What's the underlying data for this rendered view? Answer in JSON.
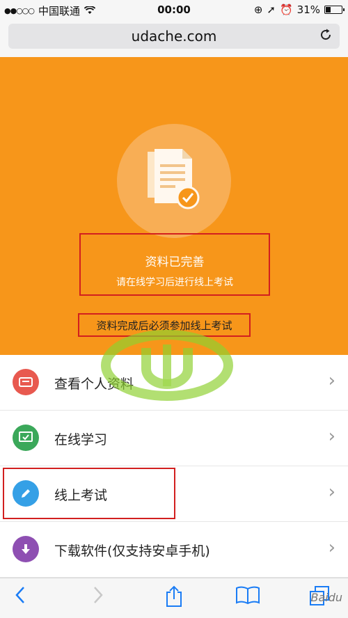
{
  "status_bar": {
    "carrier": "中国联通",
    "time": "00:00",
    "battery": "31%",
    "battery_level": 0.31
  },
  "browser": {
    "url": "udache.com"
  },
  "hero": {
    "status_title": "资料已完善",
    "status_subtitle": "请在线学习后进行线上考试",
    "notice": "资料完成后必须参加线上考试"
  },
  "menu": {
    "items": [
      {
        "label": "查看个人资料",
        "icon": "id-card-icon",
        "color": "#e8594f"
      },
      {
        "label": "在线学习",
        "icon": "monitor-check-icon",
        "color": "#3ba85a"
      },
      {
        "label": "线上考试",
        "icon": "pencil-icon",
        "color": "#35a0e6"
      },
      {
        "label": "下载软件(仅支持安卓手机)",
        "icon": "download-icon",
        "color": "#8e4fb2"
      }
    ]
  },
  "toolbar": {
    "watermark": "Baidu"
  },
  "colors": {
    "accent_orange": "#f7961a",
    "highlight_red": "#d21f1f",
    "ios_blue": "#1a7cf5"
  }
}
